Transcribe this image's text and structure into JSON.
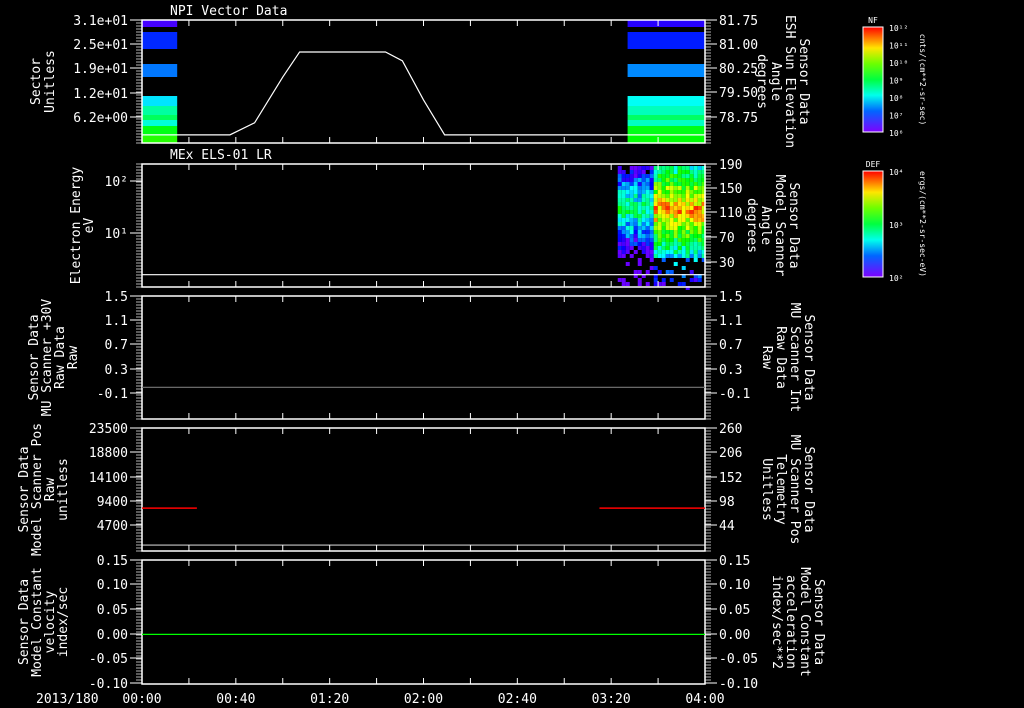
{
  "chart_data": {
    "type": "multi-panel time series / spectrogram",
    "date_label": "2013/180",
    "time_axis": {
      "unit": "hours",
      "range": [
        0,
        4
      ],
      "tick_values": [
        0,
        0.6667,
        1.3333,
        2,
        2.6667,
        3.3333,
        4
      ],
      "tick_labels": [
        "00:00",
        "00:40",
        "01:20",
        "02:00",
        "02:40",
        "03:20",
        "04:00"
      ]
    },
    "panels": [
      {
        "title": "NPI Vector Data",
        "left_label": [
          "Sector",
          "Unitless"
        ],
        "left_ticks": [
          "3.1e+01",
          "2.5e+01",
          "1.9e+01",
          "1.2e+01",
          "6.2e+00"
        ],
        "right_label": [
          "Sensor Data",
          "ESH Sun Elevation",
          "Angle",
          "degrees"
        ],
        "right_ticks": [
          "81.75",
          "81.00",
          "80.25",
          "79.50",
          "78.75"
        ],
        "right_range": [
          77.98,
          81.75
        ],
        "line": {
          "color": "#ffffff",
          "t": [
            0,
            0.625,
            0.8,
            1.0,
            1.12,
            1.73,
            1.85,
            2.0,
            2.15,
            4
          ],
          "v": [
            78.23,
            78.23,
            78.6,
            80.0,
            80.77,
            80.77,
            80.5,
            79.3,
            78.23,
            78.23
          ]
        },
        "spectrogram_blocks": [
          [
            0,
            0.25
          ],
          [
            3.45,
            4
          ]
        ],
        "colorbar": {
          "title": "NF",
          "ticks": [
            "10¹²",
            "10¹¹",
            "10¹⁰",
            "10⁹",
            "10⁸",
            "10⁷",
            "10⁶"
          ],
          "units": "cnts/(cm**2-sr-sec)"
        }
      },
      {
        "title": "MEx ELS-01 LR",
        "left_label": [
          "Electron Energy",
          "eV"
        ],
        "left_ticks": [
          "10²",
          "10¹"
        ],
        "right_label": [
          "Sensor Data",
          "Model Scanner",
          "Angle",
          "degrees"
        ],
        "right_ticks": [
          "190",
          "150",
          "110",
          "70",
          "30"
        ],
        "right_range": [
          -10,
          190
        ],
        "line": {
          "color": "#ffffff",
          "t": [
            0,
            4
          ],
          "v": [
            10,
            10
          ]
        },
        "spectrogram_blocks": [
          [
            3.38,
            4
          ]
        ],
        "colorbar": {
          "title": "DEF",
          "ticks": [
            "10⁴",
            "10³",
            "10²"
          ],
          "units": "ergs/(cm**2-sr-sec-eV)"
        }
      },
      {
        "left_label": [
          "Sensor Data",
          "MU Scanner +30V",
          "Raw Data",
          "Raw"
        ],
        "left_ticks": [
          "1.5",
          "1.1",
          "0.7",
          "0.3",
          "-0.1"
        ],
        "right_label": [
          "Sensor Data",
          "MU Scanner Int",
          "Raw Data",
          "Raw"
        ],
        "right_ticks": [
          "1.5",
          "1.1",
          "0.7",
          "0.3",
          "-0.1"
        ],
        "right_label_color": "#ff0000",
        "right_range": [
          -0.52,
          1.5
        ],
        "line": {
          "color": "#777777",
          "t": [
            0,
            4
          ],
          "v": [
            0,
            0
          ]
        }
      },
      {
        "left_label": [
          "Sensor Data",
          "Model Scanner Pos",
          "Raw",
          "unitless"
        ],
        "left_ticks": [
          "23500",
          "18800",
          "14100",
          "9400",
          "4700"
        ],
        "right_label": [
          "Sensor Data",
          "MU Scanner Pos",
          "Telemetry",
          "Unitless"
        ],
        "right_ticks": [
          "260",
          "206",
          "152",
          "98",
          "44"
        ],
        "right_label_color": "#ff0000",
        "right_range": [
          -10,
          260
        ],
        "line": {
          "color": "#ff0000",
          "segments": [
            [
              0,
              0.39
            ],
            [
              3.25,
              4
            ]
          ],
          "v": 84
        },
        "baseline": {
          "color": "#ffffff",
          "v": 3
        }
      },
      {
        "left_label": [
          "Sensor Data",
          "Model Constant",
          "velocity",
          "index/sec"
        ],
        "left_ticks": [
          "0.15",
          "0.10",
          "0.05",
          "0.00",
          "-0.05",
          "-0.10"
        ],
        "right_label": [
          "Sensor Data",
          "Model Constant",
          "acceleration",
          "index/sec**2"
        ],
        "right_ticks": [
          "0.15",
          "0.10",
          "0.05",
          "0.00",
          "-0.05",
          "-0.10"
        ],
        "right_label_color": "#00ff00",
        "right_range": [
          -0.1,
          0.15
        ],
        "line": {
          "color": "#00ff00",
          "t": [
            0,
            4
          ],
          "v": [
            0,
            0
          ]
        }
      }
    ]
  }
}
